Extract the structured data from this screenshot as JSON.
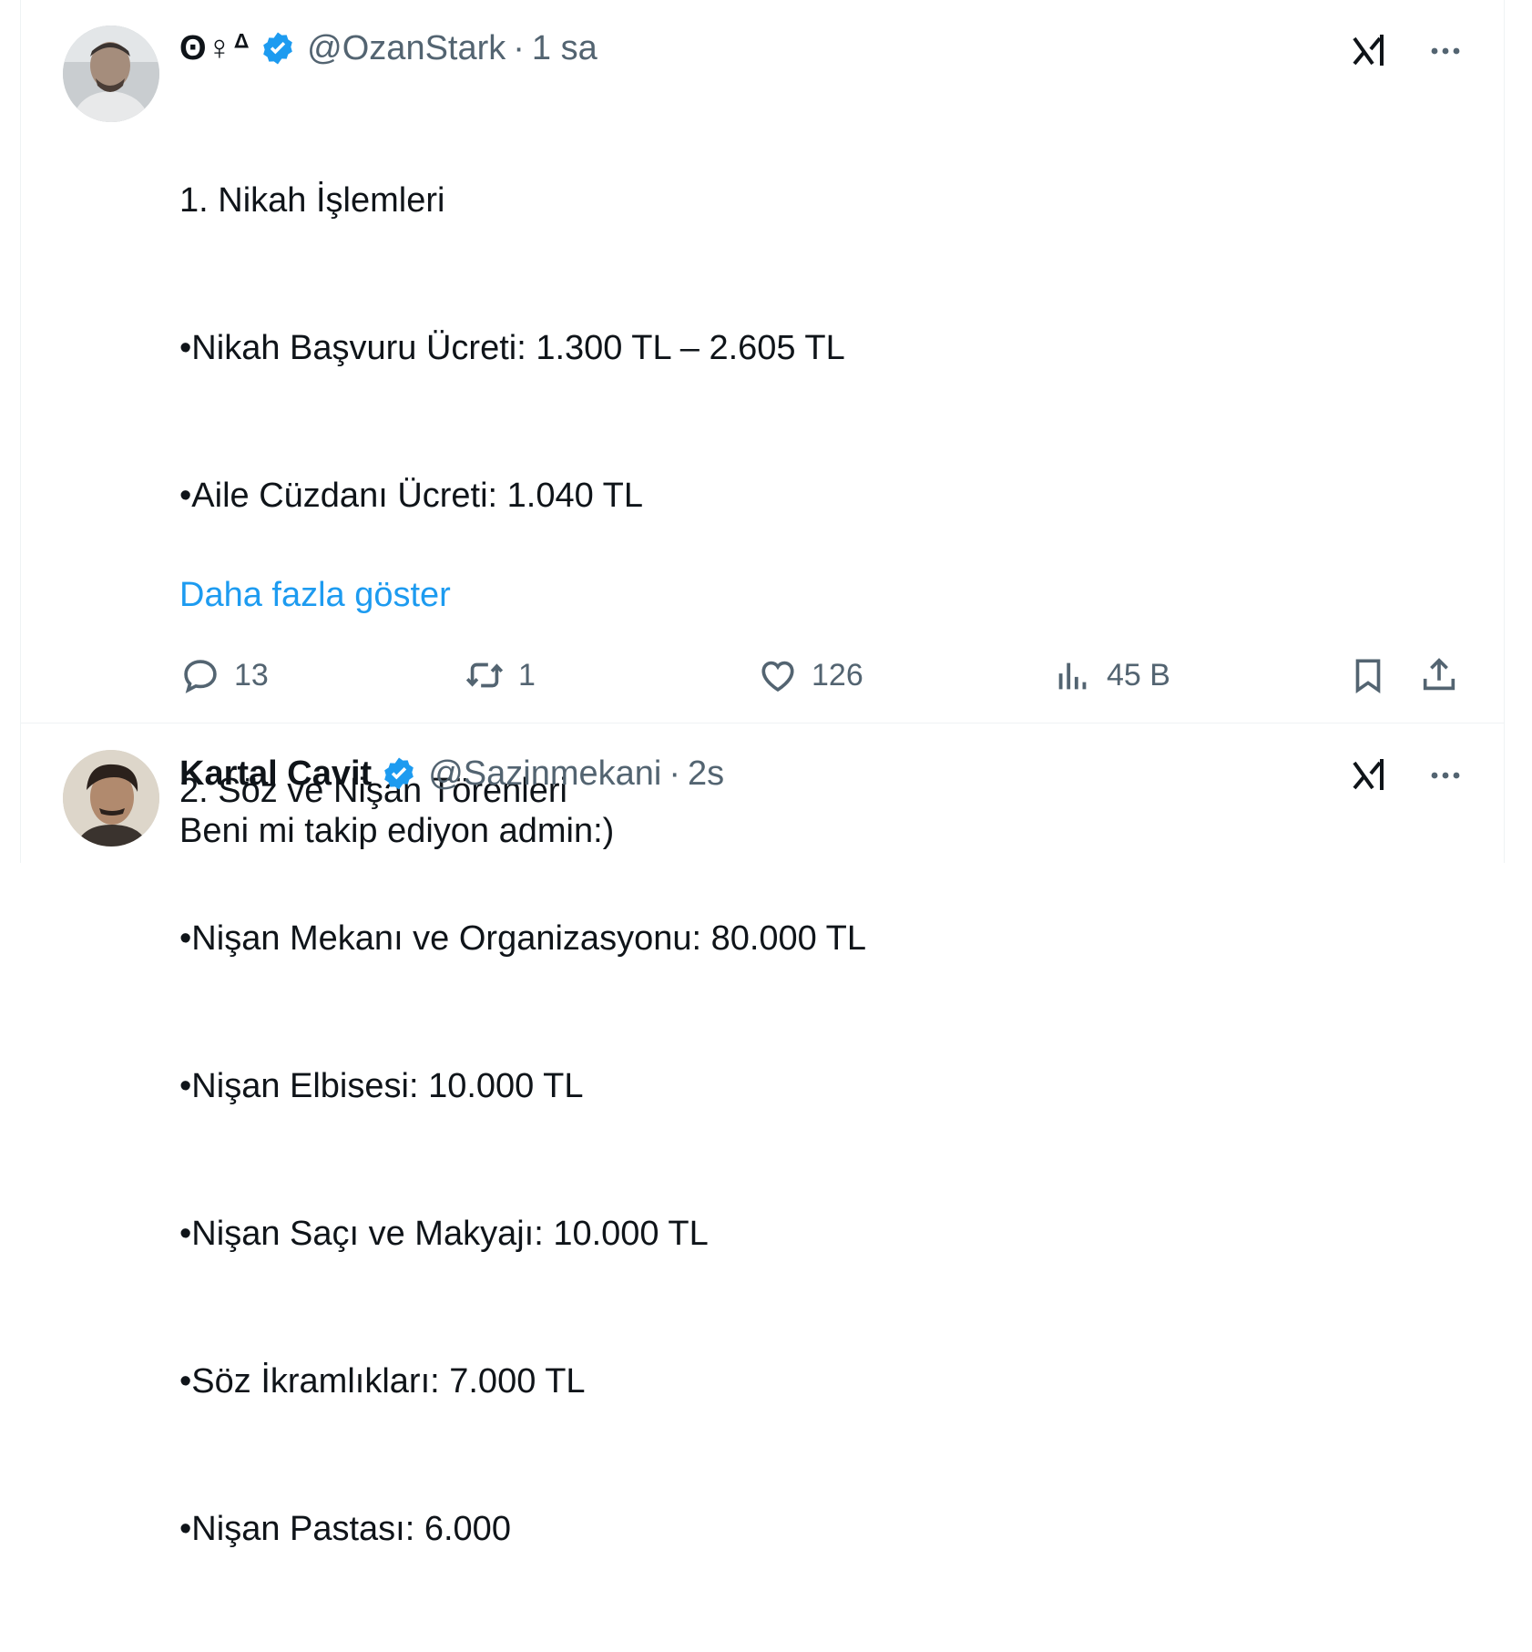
{
  "tweets": [
    {
      "display_name": "ʘ♀ᐞ",
      "handle": "@OzanStark",
      "separator": "·",
      "time": "1 sa",
      "lines": [
        "1. Nikah İşlemleri",
        "•Nikah Başvuru Ücreti: 1.300 TL – 2.605 TL",
        "•Aile Cüzdanı Ücreti: 1.040 TL",
        "",
        "2. Söz ve Nişan Törenleri",
        "•Nişan Mekanı ve Organizasyonu: 80.000 TL",
        "•Nişan Elbisesi: 10.000 TL",
        "•Nişan Saçı ve Makyajı: 10.000 TL",
        "•Söz İkramlıkları: 7.000 TL",
        "•Nişan Pastası: 6.000"
      ],
      "show_more": "Daha fazla göster",
      "actions": {
        "replies": "13",
        "retweets": "1",
        "likes": "126",
        "views": "45 B"
      },
      "icons": [
        "verified-badge-icon",
        "grok-icon",
        "more-icon",
        "reply-icon",
        "retweet-icon",
        "like-icon",
        "views-icon",
        "bookmark-icon",
        "share-icon"
      ]
    },
    {
      "display_name": "Kartal Cavit",
      "handle": "@Sazinmekani",
      "separator": "·",
      "time": "2s",
      "text": "Beni mi takip ediyon admin:)"
    }
  ],
  "colors": {
    "verified": "#1d9bf0",
    "link": "#1d9bf0",
    "secondary_text": "#536471",
    "border": "#eff3f4"
  }
}
